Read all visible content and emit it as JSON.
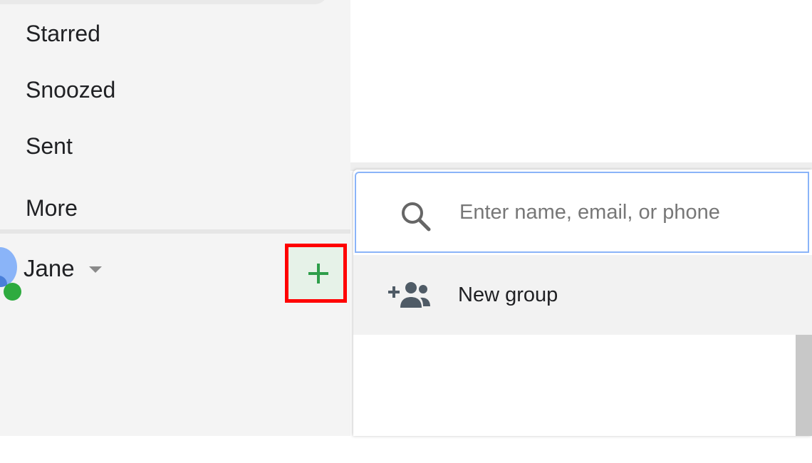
{
  "sidebar": {
    "items": [
      {
        "label": "Starred"
      },
      {
        "label": "Snoozed"
      },
      {
        "label": "Sent"
      },
      {
        "label": "More"
      }
    ]
  },
  "hangouts": {
    "user_name": "Jane",
    "presence_color": "#2eab3f",
    "add_button_icon": "plus-icon",
    "add_button_color": "#2e9e4a",
    "highlight_color": "#ff0000"
  },
  "popup": {
    "search": {
      "placeholder": "Enter name, email, or phone",
      "icon": "search-icon"
    },
    "new_group": {
      "label": "New group",
      "icon": "group-add-icon"
    }
  }
}
